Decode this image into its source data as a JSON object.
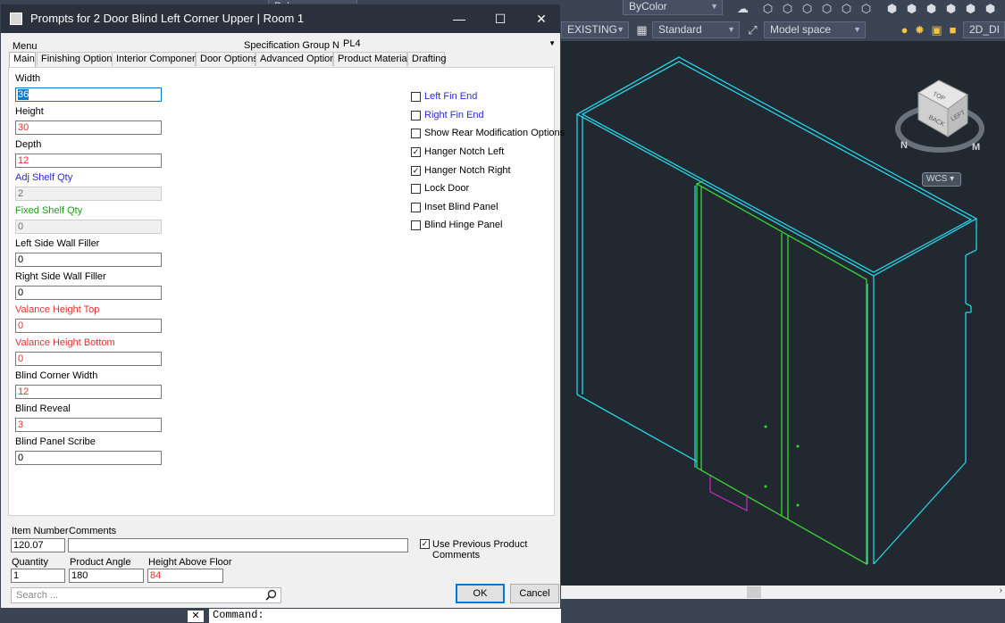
{
  "cad": {
    "combo_layer": "ByLayer",
    "combo_color": "ByColor",
    "combo_layer_state": "EXISTING",
    "combo_style": "Standard",
    "combo_space": "Model space",
    "tab_drawing": "2D_DI",
    "viewcube_top": "TOP",
    "viewcube_back": "BACK",
    "viewcube_left": "LEFT",
    "compass_m": "M",
    "compass_n": "N",
    "wcs": "WCS",
    "command_prompt": "Command:"
  },
  "dialog": {
    "title": "Prompts for 2 Door Blind Left Corner Upper | Room 1",
    "menu": "Menu",
    "spec_group_label": "Specification Group Name",
    "spec_group_value": "PL4",
    "tabs": [
      {
        "label": "Main"
      },
      {
        "label": "Finishing Options"
      },
      {
        "label": "Interior Components"
      },
      {
        "label": "Door Options"
      },
      {
        "label": "Advanced Options"
      },
      {
        "label": "Product Materials"
      },
      {
        "label": "Drafting"
      }
    ],
    "fields": [
      {
        "label": "Width",
        "value": "36"
      },
      {
        "label": "Height",
        "value": "30"
      },
      {
        "label": "Depth",
        "value": "12"
      },
      {
        "label": "Adj Shelf Qty",
        "value": "2"
      },
      {
        "label": "Fixed Shelf Qty",
        "value": "0"
      },
      {
        "label": "Left Side Wall Filler",
        "value": "0"
      },
      {
        "label": "Right Side Wall Filler",
        "value": "0"
      },
      {
        "label": "Valance Height Top",
        "value": "0"
      },
      {
        "label": "Valance Height Bottom",
        "value": "0"
      },
      {
        "label": "Blind Corner Width",
        "value": "12"
      },
      {
        "label": "Blind Reveal",
        "value": "3"
      },
      {
        "label": "Blind Panel Scribe",
        "value": "0"
      }
    ],
    "checkboxes": [
      {
        "label": "Left Fin End",
        "checked": false
      },
      {
        "label": "Right Fin End",
        "checked": false
      },
      {
        "label": "Show Rear Modification Options",
        "checked": false
      },
      {
        "label": "Hanger Notch Left",
        "checked": true
      },
      {
        "label": "Hanger Notch Right",
        "checked": true
      },
      {
        "label": "Lock Door",
        "checked": false
      },
      {
        "label": "Inset Blind Panel",
        "checked": false
      },
      {
        "label": "Blind Hinge Panel",
        "checked": false
      }
    ],
    "footer": {
      "item_number_label": "Item Number",
      "item_number": "120.07",
      "comments_label": "Comments",
      "comments": "",
      "use_previous_label": "Use Previous Product Comments",
      "use_previous_checked": true,
      "quantity_label": "Quantity",
      "quantity": "1",
      "product_angle_label": "Product Angle",
      "product_angle": "180",
      "height_above_floor_label": "Height Above Floor",
      "height_above_floor": "84",
      "search_placeholder": "Search ...",
      "ok": "OK",
      "cancel": "Cancel"
    }
  }
}
